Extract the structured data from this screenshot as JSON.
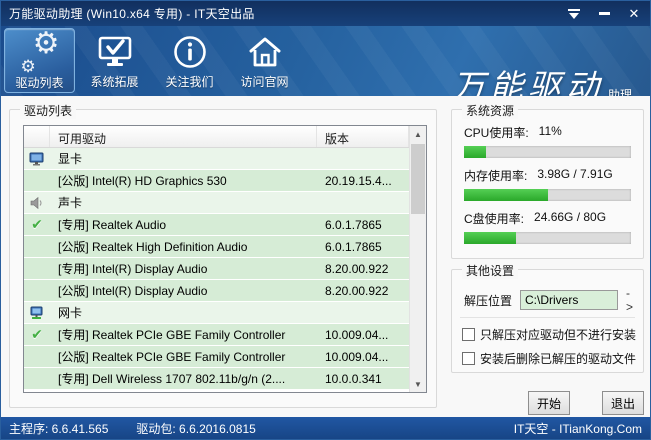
{
  "window": {
    "title": "万能驱动助理 (Win10.x64 专用) - IT天空出品"
  },
  "toolbar": {
    "items": [
      {
        "label": "驱动列表",
        "icon": "gears-icon",
        "active": true
      },
      {
        "label": "系统拓展",
        "icon": "monitor-check-icon",
        "active": false
      },
      {
        "label": "关注我们",
        "icon": "info-circle-icon",
        "active": false
      },
      {
        "label": "访问官网",
        "icon": "home-icon",
        "active": false
      }
    ],
    "logo_main": "万能驱动",
    "logo_suffix": "助理"
  },
  "driver_panel": {
    "title": "驱动列表",
    "columns": {
      "name": "可用驱动",
      "version": "版本"
    },
    "rows": [
      {
        "type": "category",
        "label": "显卡",
        "icon": "gpu-icon"
      },
      {
        "type": "driver",
        "checked": false,
        "name": "[公版] Intel(R) HD Graphics 530",
        "version": "20.19.15.4..."
      },
      {
        "type": "category",
        "label": "声卡",
        "icon": "audio-icon"
      },
      {
        "type": "driver",
        "checked": true,
        "name": "[专用] Realtek Audio",
        "version": "6.0.1.7865"
      },
      {
        "type": "driver",
        "checked": false,
        "name": "[公版] Realtek High Definition Audio",
        "version": "6.0.1.7865"
      },
      {
        "type": "driver",
        "checked": false,
        "name": "[专用] Intel(R) Display Audio",
        "version": "8.20.00.922"
      },
      {
        "type": "driver",
        "checked": false,
        "name": "[公版] Intel(R) Display Audio",
        "version": "8.20.00.922"
      },
      {
        "type": "category",
        "label": "网卡",
        "icon": "network-icon"
      },
      {
        "type": "driver",
        "checked": true,
        "name": "[专用] Realtek PCIe GBE Family Controller",
        "version": "10.009.04..."
      },
      {
        "type": "driver",
        "checked": false,
        "name": "[公版] Realtek PCIe GBE Family Controller",
        "version": "10.009.04..."
      },
      {
        "type": "driver",
        "checked": false,
        "name": "[专用] Dell Wireless 1707 802.11b/g/n (2....",
        "version": "10.0.0.341"
      }
    ]
  },
  "system_resources": {
    "title": "系统资源",
    "bar_color": "#2fbe2f",
    "meters": [
      {
        "label": "CPU使用率:",
        "value": "11%",
        "percent": 13
      },
      {
        "label": "内存使用率:",
        "value": "3.98G / 7.91G",
        "percent": 50
      },
      {
        "label": "C盘使用率:",
        "value": "24.66G / 80G",
        "percent": 31
      }
    ]
  },
  "other_settings": {
    "title": "其他设置",
    "extract_label": "解压位置",
    "extract_path": "C:\\Drivers",
    "browse_label": "->",
    "checkboxes": [
      {
        "label": "只解压对应驱动但不进行安装",
        "checked": false
      },
      {
        "label": "安装后删除已解压的驱动文件",
        "checked": false
      }
    ]
  },
  "actions": {
    "start": "开始",
    "exit": "退出"
  },
  "status_bar": {
    "main_program": "主程序: 6.6.41.565",
    "driver_pack": "驱动包: 6.6.2016.0815",
    "brand": "IT天空 - ITianKong.Com"
  }
}
